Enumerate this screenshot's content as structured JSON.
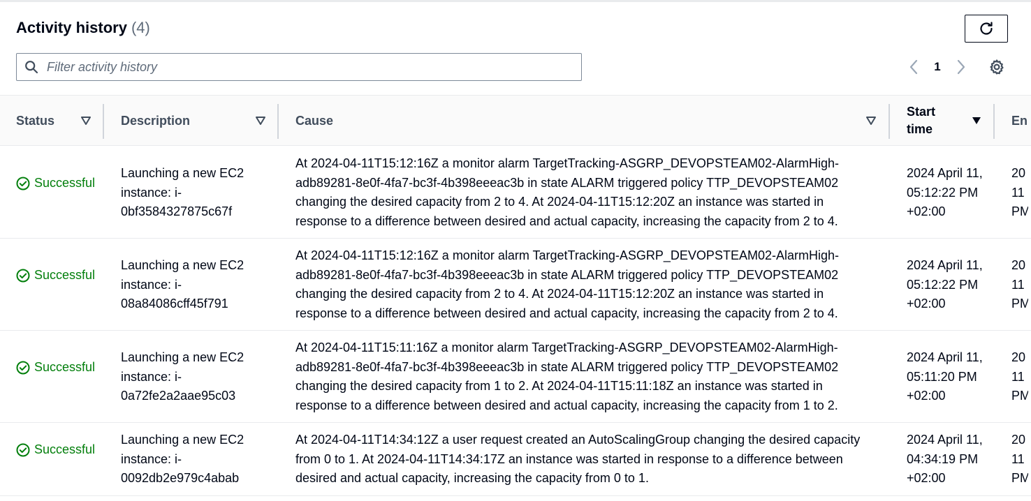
{
  "header": {
    "title": "Activity history",
    "count": "(4)"
  },
  "filter": {
    "placeholder": "Filter activity history",
    "value": ""
  },
  "pagination": {
    "current_page": "1"
  },
  "table": {
    "columns": {
      "status": "Status",
      "description": "Description",
      "cause": "Cause",
      "start_time": "Start time",
      "end_time": "En"
    },
    "rows": [
      {
        "status": "Successful",
        "description": "Launching a new EC2 instance: i-0bf3584327875c67f",
        "cause": "At 2024-04-11T15:12:16Z a monitor alarm TargetTracking-ASGRP_DEVOPSTEAM02-AlarmHigh-adb89281-8e0f-4fa7-bc3f-4b398eeeac3b in state ALARM triggered policy TTP_DEVOPSTEAM02 changing the desired capacity from 2 to 4. At 2024-04-11T15:12:20Z an instance was started in response to a difference between desired and actual capacity, increasing the capacity from 2 to 4.",
        "start_time": "2024 April 11, 05:12:22 PM +02:00",
        "end_time": "20 11 PM"
      },
      {
        "status": "Successful",
        "description": "Launching a new EC2 instance: i-08a84086cff45f791",
        "cause": "At 2024-04-11T15:12:16Z a monitor alarm TargetTracking-ASGRP_DEVOPSTEAM02-AlarmHigh-adb89281-8e0f-4fa7-bc3f-4b398eeeac3b in state ALARM triggered policy TTP_DEVOPSTEAM02 changing the desired capacity from 2 to 4. At 2024-04-11T15:12:20Z an instance was started in response to a difference between desired and actual capacity, increasing the capacity from 2 to 4.",
        "start_time": "2024 April 11, 05:12:22 PM +02:00",
        "end_time": "20 11 PM"
      },
      {
        "status": "Successful",
        "description": "Launching a new EC2 instance: i-0a72fe2a2aae95c03",
        "cause": "At 2024-04-11T15:11:16Z a monitor alarm TargetTracking-ASGRP_DEVOPSTEAM02-AlarmHigh-adb89281-8e0f-4fa7-bc3f-4b398eeeac3b in state ALARM triggered policy TTP_DEVOPSTEAM02 changing the desired capacity from 1 to 2. At 2024-04-11T15:11:18Z an instance was started in response to a difference between desired and actual capacity, increasing the capacity from 1 to 2.",
        "start_time": "2024 April 11, 05:11:20 PM +02:00",
        "end_time": "20 11 PM"
      },
      {
        "status": "Successful",
        "description": "Launching a new EC2 instance: i-0092db2e979c4abab",
        "cause": "At 2024-04-11T14:34:12Z a user request created an AutoScalingGroup changing the desired capacity from 0 to 1. At 2024-04-11T14:34:17Z an instance was started in response to a difference between desired and actual capacity, increasing the capacity from 0 to 1.",
        "start_time": "2024 April 11, 04:34:19 PM +02:00",
        "end_time": "20 11 PM"
      }
    ]
  },
  "colors": {
    "success": "#037f0c",
    "header_text": "#414d5c",
    "body_text": "#000716"
  },
  "icons": {
    "refresh": "refresh-icon",
    "search": "search-icon",
    "prev": "chevron-left-icon",
    "next": "chevron-right-icon",
    "settings": "gear-icon",
    "sort": "caret-down-icon",
    "status": "check-circle-icon"
  }
}
